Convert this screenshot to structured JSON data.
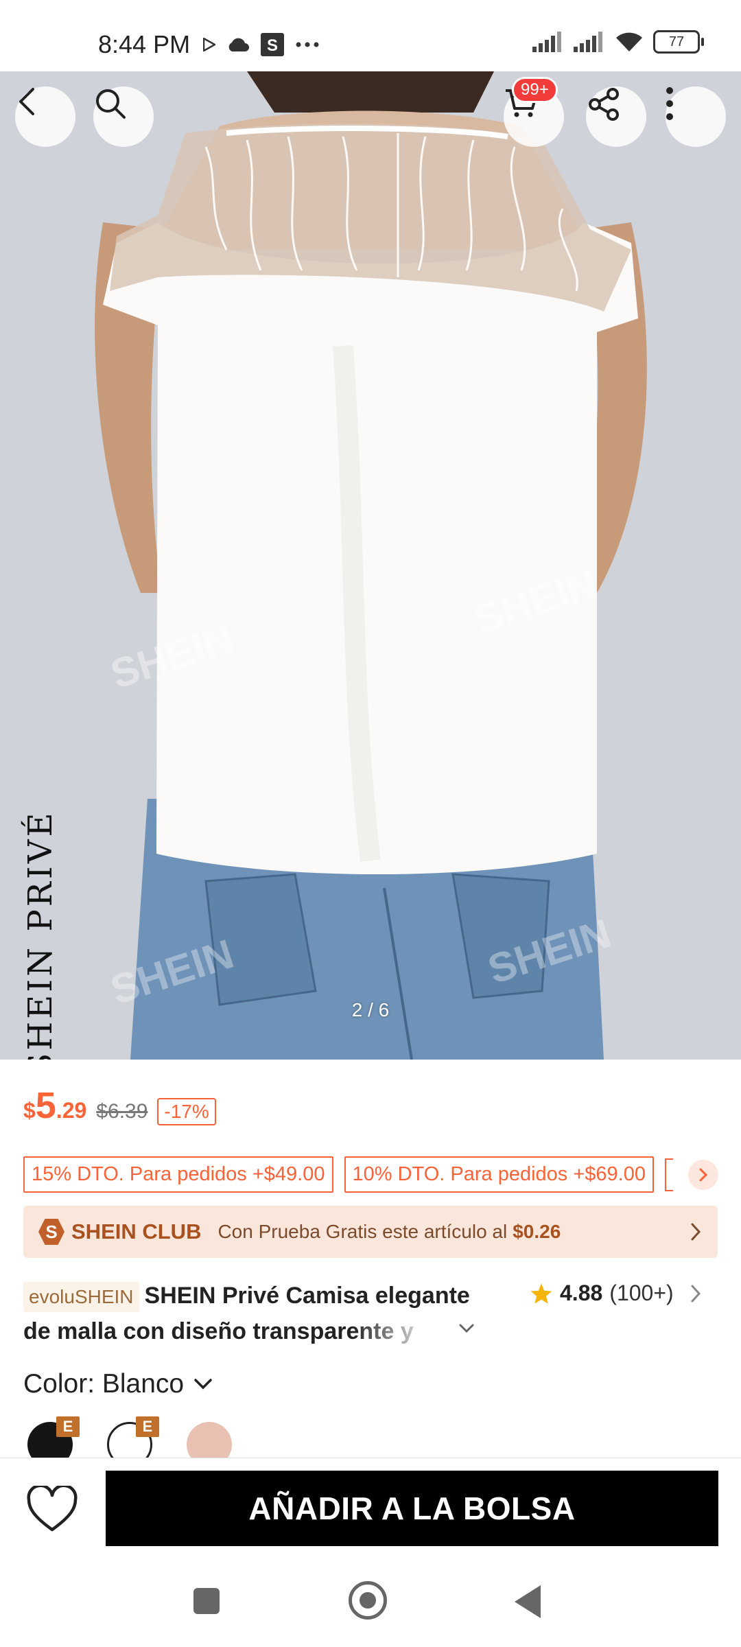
{
  "status_bar": {
    "time": "8:44 PM",
    "battery": "77"
  },
  "hero": {
    "brand_vertical": "SHEIN PRIVÉ",
    "watermark": "SHEIN",
    "counter": "2 / 6",
    "cart_badge": "99+"
  },
  "price": {
    "currency": "$",
    "integer": "5",
    "decimal": ".29",
    "original": "$6.39",
    "discount": "-17%"
  },
  "coupons": [
    "15% DTO. Para pedidos +$49.00",
    "10% DTO. Para pedidos +$69.00"
  ],
  "club": {
    "logo": "S",
    "name": "SHEIN CLUB",
    "text": "Con Prueba Gratis este artículo al",
    "amount": "$0.26"
  },
  "product": {
    "tag": "evoluSHEIN",
    "title": "SHEIN Privé Camisa elegante de malla con diseño transparente y"
  },
  "rating": {
    "value": "4.88",
    "count": "(100+)"
  },
  "color": {
    "label": "Color: Blanco",
    "badge": "E"
  },
  "actions": {
    "add_to_bag": "AÑADIR A LA BOLSA"
  }
}
